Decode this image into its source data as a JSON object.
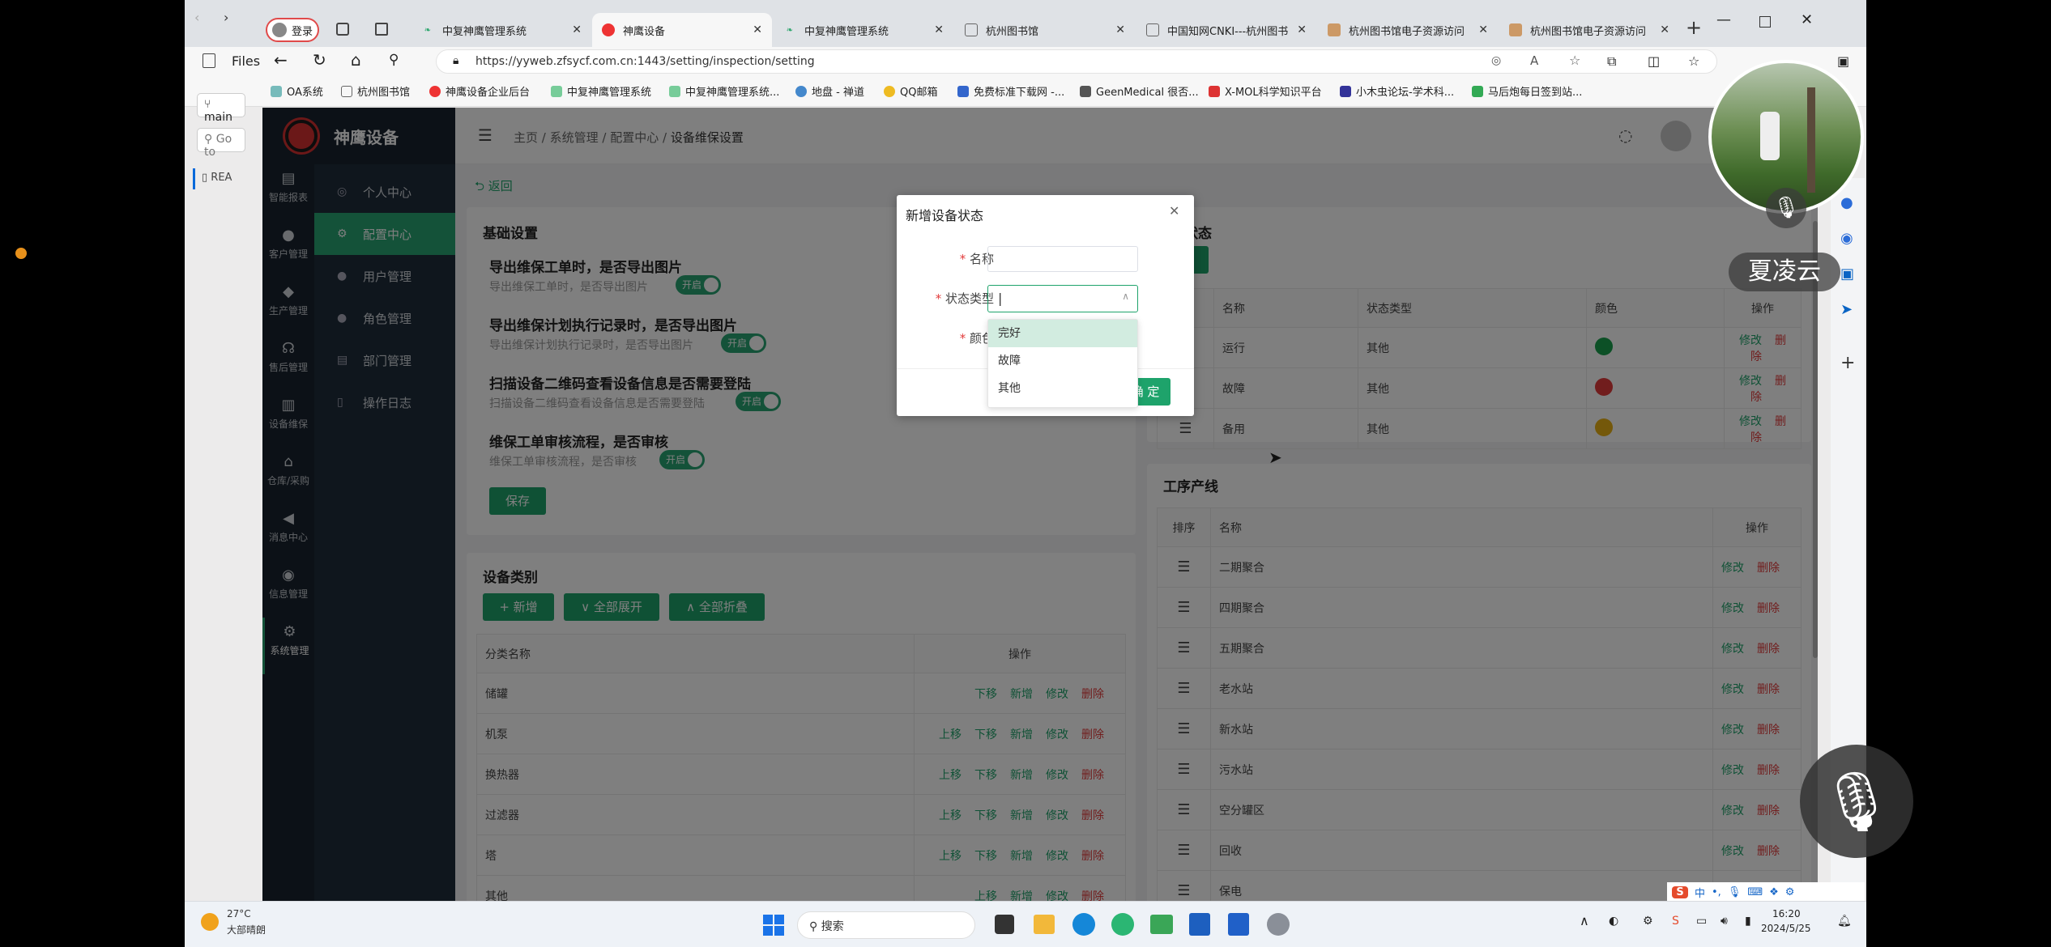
{
  "browser": {
    "tabs": [
      {
        "label": "登录",
        "active": false
      },
      {
        "label": "",
        "active": false
      },
      {
        "label": "",
        "active": false
      },
      {
        "label": "中复神鹰管理系统",
        "active": false
      },
      {
        "label": "神鹰设备",
        "active": true
      },
      {
        "label": "中复神鹰管理系统",
        "active": false
      },
      {
        "label": "杭州图书馆",
        "active": false
      },
      {
        "label": "中国知网CNKI---杭州图书",
        "active": false
      },
      {
        "label": "杭州图书馆电子资源访问",
        "active": false
      },
      {
        "label": "杭州图书馆电子资源访问",
        "active": false
      }
    ],
    "url": "https://yyweb.zfsycf.com.cn:1443/setting/inspection/setting",
    "bookmarks": [
      "OA系统",
      "杭州图书馆",
      "神鹰设备企业后台",
      "中复神鹰管理系统",
      "中复神鹰管理系统...",
      "地盘 - 禅道",
      "QQ邮箱",
      "免费标准下载网 -...",
      "GeenMedical 很否...",
      "X-MOL科学知识平台",
      "小木虫论坛-学术科...",
      "马后炮每日签到站..."
    ]
  },
  "left_panel": {
    "files_label": "Files",
    "branch": "main",
    "goto": "Go to",
    "readme": "REA"
  },
  "app": {
    "logo": "神鹰设备",
    "icon_nav": [
      "智能报表",
      "客户管理",
      "生产管理",
      "售后管理",
      "设备维保",
      "仓库/采购",
      "消息中心",
      "信息管理",
      "系统管理"
    ],
    "menu": [
      "个人中心",
      "配置中心",
      "用户管理",
      "角色管理",
      "部门管理",
      "操作日志"
    ],
    "menu_active": 1,
    "breadcrumb": [
      "主页",
      "系统管理",
      "配置中心",
      "设备维保设置"
    ],
    "back": "返回"
  },
  "basic_settings": {
    "title": "基础设置",
    "rows": [
      {
        "title": "导出维保工单时，是否导出图片",
        "sub": "导出维保工单时，是否导出图片",
        "toggle": "开启"
      },
      {
        "title": "导出维保计划执行记录时，是否导出图片",
        "sub": "导出维保计划执行记录时，是否导出图片",
        "toggle": "开启"
      },
      {
        "title": "扫描设备二维码查看设备信息是否需要登陆",
        "sub": "扫描设备二维码查看设备信息是否需要登陆",
        "toggle": "开启"
      },
      {
        "title": "维保工单审核流程，是否审核",
        "sub": "维保工单审核流程，是否审核",
        "toggle": "开启"
      }
    ],
    "save": "保存"
  },
  "device_category": {
    "title": "设备类别",
    "buttons": [
      "+ 新增",
      "∨ 全部展开",
      "∧ 全部折叠"
    ],
    "headers": [
      "分类名称",
      "操作"
    ],
    "rows": [
      {
        "name": "储罐",
        "ops": [
          "下移",
          "新增",
          "修改",
          "删除"
        ]
      },
      {
        "name": "机泵",
        "ops": [
          "上移",
          "下移",
          "新增",
          "修改",
          "删除"
        ]
      },
      {
        "name": "换热器",
        "ops": [
          "上移",
          "下移",
          "新增",
          "修改",
          "删除"
        ]
      },
      {
        "name": "过滤器",
        "ops": [
          "上移",
          "下移",
          "新增",
          "修改",
          "删除"
        ]
      },
      {
        "name": "塔",
        "ops": [
          "上移",
          "下移",
          "新增",
          "修改",
          "删除"
        ]
      },
      {
        "name": "其他",
        "ops": [
          "上移",
          "新增",
          "修改",
          "删除"
        ]
      }
    ]
  },
  "device_status": {
    "title": "状态",
    "headers": [
      "名称",
      "状态类型",
      "颜色",
      "操作"
    ],
    "rows": [
      {
        "name": "运行",
        "type": "其他",
        "color": "#19a04c"
      },
      {
        "name": "故障",
        "type": "其他",
        "color": "#e23b3b"
      },
      {
        "name": "备用",
        "type": "其他",
        "color": "#e8b015"
      }
    ],
    "ops": [
      "修改",
      "删除"
    ]
  },
  "production_line": {
    "title": "工序产线",
    "headers": [
      "排序",
      "名称",
      "操作"
    ],
    "rows": [
      "二期聚合",
      "四期聚合",
      "五期聚合",
      "老水站",
      "新水站",
      "污水站",
      "空分罐区",
      "回收",
      "保电"
    ],
    "ops": [
      "修改",
      "删除"
    ]
  },
  "dialog": {
    "title": "新增设备状态",
    "fields": [
      {
        "label": "名称",
        "value": ""
      },
      {
        "label": "状态类型",
        "value": "|"
      },
      {
        "label": "颜色",
        "value": ""
      }
    ],
    "confirm": "确 定",
    "options": [
      "完好",
      "故障",
      "其他"
    ],
    "highlighted": 0
  },
  "webcam": {
    "name": "夏凌云"
  },
  "taskbar": {
    "weather_temp": "27°C",
    "weather_desc": "大部晴朗",
    "search": "搜索",
    "time": "16:20",
    "date": "2024/5/25",
    "ime": "中"
  },
  "colors": {
    "accent": "#1ea36b",
    "danger": "#e23b3b",
    "sidebar": "#1f2d3a"
  }
}
